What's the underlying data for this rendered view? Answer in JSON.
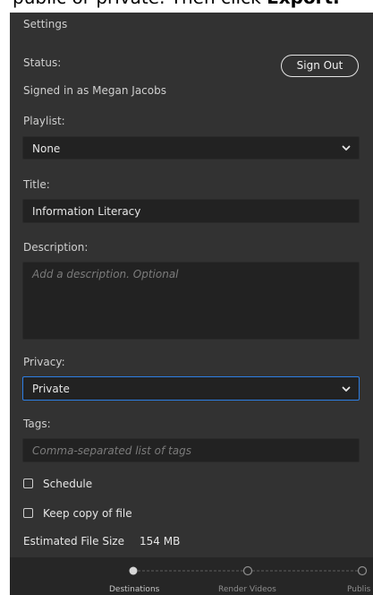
{
  "top_caption": {
    "before": "public or private. Then click ",
    "bold": "Export."
  },
  "colors": {
    "panel_bg": "#323232",
    "field_bg": "#222222",
    "footer_bg": "#262626",
    "accent_focus": "#2d7ee3",
    "text": "#e6e6e6",
    "label": "#cfcfcf",
    "placeholder": "#7b7b7b"
  },
  "settings": {
    "heading": "Settings",
    "status_label": "Status:",
    "signed_in_text": "Signed in as Megan Jacobs",
    "sign_out_label": "Sign Out",
    "playlist_label": "Playlist:",
    "playlist_value": "None",
    "title_label": "Title:",
    "title_value": "Information Literacy",
    "description_label": "Description:",
    "description_placeholder": "Add a description. Optional",
    "privacy_label": "Privacy:",
    "privacy_value": "Private",
    "tags_label": "Tags:",
    "tags_placeholder": "Comma-separated list of tags",
    "schedule_label": "Schedule",
    "schedule_checked": false,
    "keep_copy_label": "Keep copy of file",
    "keep_copy_checked": false,
    "file_size_label": "Estimated File Size",
    "file_size_value": "154 MB",
    "chevron_icon": "chevron-down-icon"
  },
  "steps": [
    {
      "label": "Destinations",
      "active": true
    },
    {
      "label": "Render Videos",
      "active": false
    },
    {
      "label": "Publis",
      "active": false
    }
  ]
}
